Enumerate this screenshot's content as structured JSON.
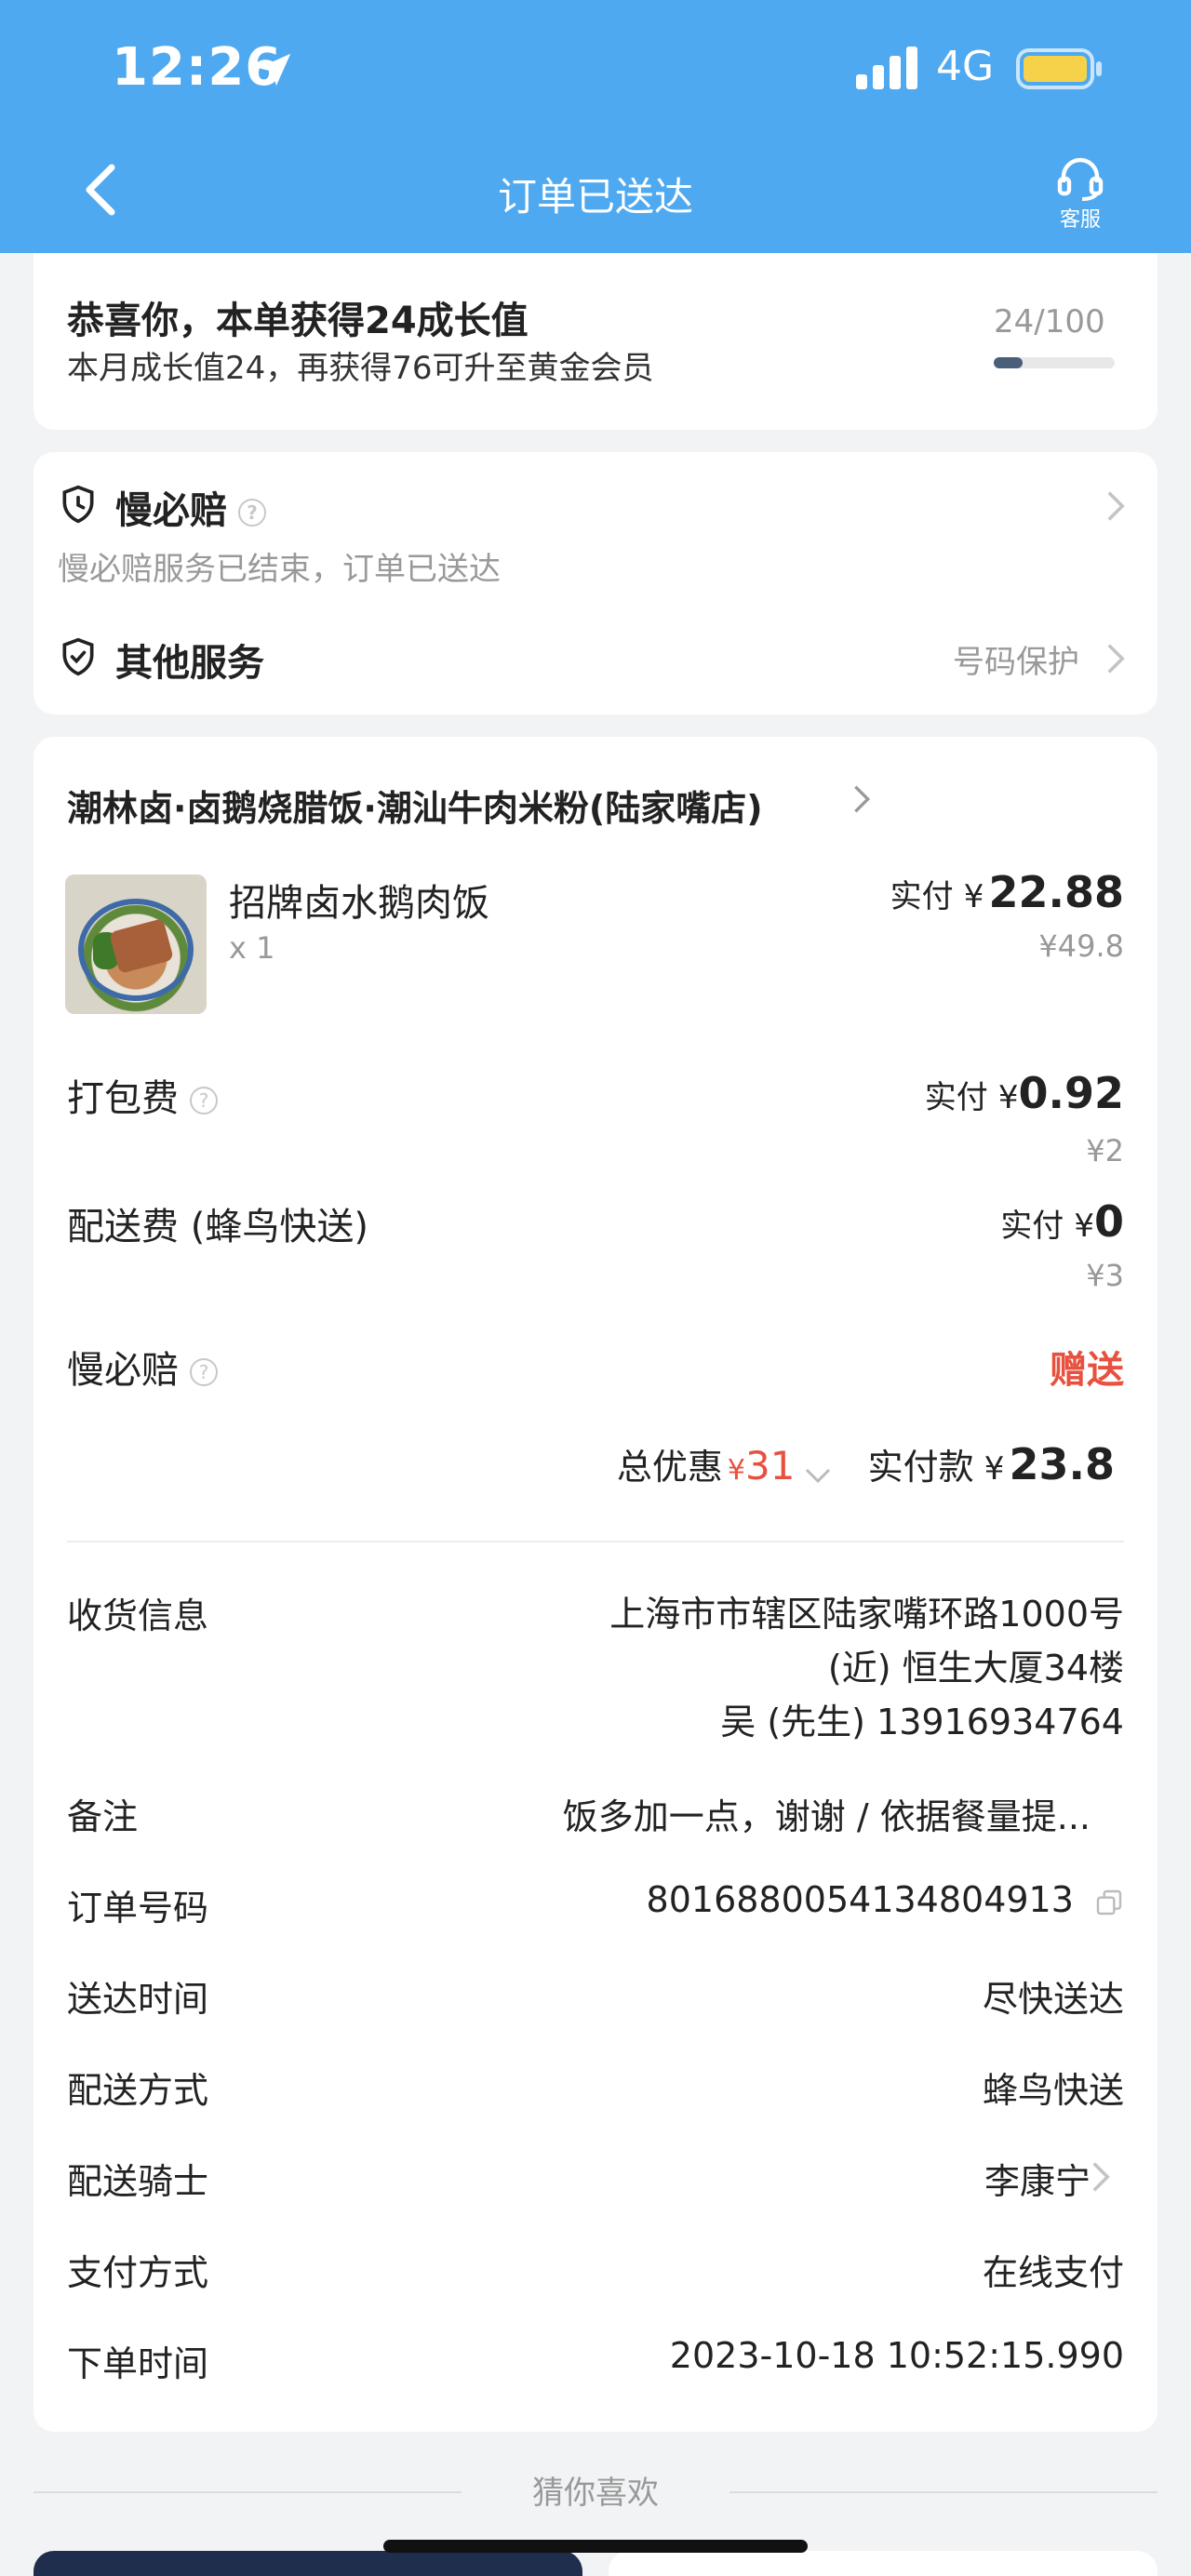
{
  "status_bar": {
    "time": "12:26",
    "network": "4G"
  },
  "header": {
    "title": "订单已送达",
    "service_label": "客服"
  },
  "growth": {
    "title": "恭喜你，本单获得24成长值",
    "subtitle": "本月成长值24，再获得76可升至黄金会员",
    "progress_text": "24/100",
    "progress_fraction": 0.24
  },
  "services": {
    "slow_compensation": {
      "label": "慢必赔",
      "description": "慢必赔服务已结束，订单已送达"
    },
    "other": {
      "label": "其他服务",
      "value": "号码保护"
    }
  },
  "order": {
    "store_name": "潮林卤·卤鹅烧腊饭·潮汕牛肉米粉(陆家嘴店)",
    "item": {
      "name": "招牌卤水鹅肉饭",
      "qty": "x 1",
      "paid_label": "实付",
      "currency": "¥",
      "paid": "22.88",
      "original": "¥49.8"
    },
    "packing": {
      "label": "打包费",
      "paid_label": "实付",
      "currency": "¥",
      "paid": "0.92",
      "original": "¥2"
    },
    "delivery": {
      "label": "配送费 (蜂鸟快送)",
      "paid_label": "实付",
      "currency": "¥",
      "paid": "0",
      "original": "¥3"
    },
    "slow_comp": {
      "label": "慢必赔",
      "value": "赠送"
    },
    "totals": {
      "discount_label": "总优惠",
      "discount_currency": "¥",
      "discount": "31",
      "paid_label": "实付款",
      "paid_currency": "¥",
      "paid": "23.8"
    },
    "info_rows": [
      {
        "label": "收货信息",
        "lines": [
          "上海市市辖区陆家嘴环路1000号",
          "(近) 恒生大厦34楼",
          "吴 (先生) 13916934764"
        ]
      },
      {
        "label": "备注",
        "value": "饭多加一点，谢谢 / 依据餐量提..."
      },
      {
        "label": "订单号码",
        "value": "8016880054134804913"
      },
      {
        "label": "送达时间",
        "value": "尽快送达"
      },
      {
        "label": "配送方式",
        "value": "蜂鸟快送"
      },
      {
        "label": "配送骑士",
        "value": "李康宁"
      },
      {
        "label": "支付方式",
        "value": "在线支付"
      },
      {
        "label": "下单时间",
        "value": "2023-10-18 10:52:15.990"
      }
    ]
  },
  "recommend": {
    "label": "猜你喜欢"
  },
  "colors": {
    "header_bg": "#4fa9f0",
    "accent_red": "#e8513f",
    "page_bg": "#f2f3f5"
  }
}
